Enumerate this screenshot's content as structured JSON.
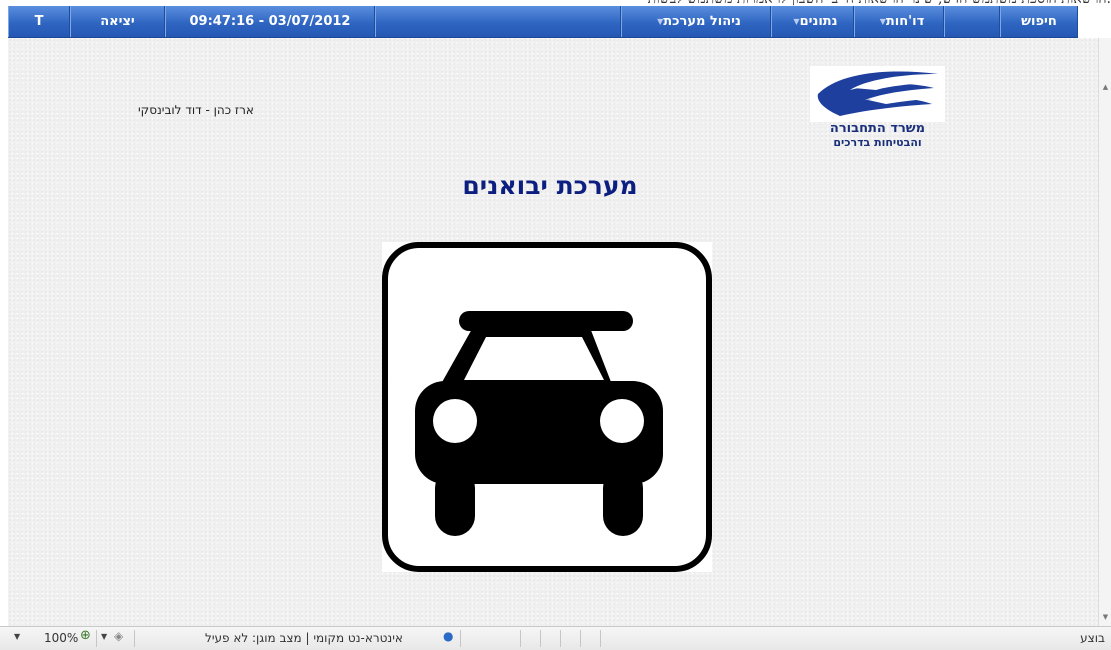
{
  "window": {
    "partial_title": "הרשאות הוספת משתמש חדש, שינוי הרשאות חייבי השבון לו אמרות משתמש לבשות."
  },
  "menubar": {
    "items": [
      {
        "label": "T",
        "has_arrow": false
      },
      {
        "label": "יציאה",
        "has_arrow": false
      },
      {
        "label": "09:47:16 - 03/07/2012",
        "has_arrow": false
      },
      {
        "label": "",
        "has_arrow": false
      },
      {
        "label": "ניהול מערכת",
        "has_arrow": true
      },
      {
        "label": "נתונים",
        "has_arrow": true
      },
      {
        "label": "דו'חות",
        "has_arrow": true
      },
      {
        "label": "",
        "has_arrow": false
      },
      {
        "label": "חיפוש",
        "has_arrow": false
      }
    ],
    "arrow_glyph": "▼"
  },
  "content": {
    "user_line": "ארז כהן - דוד לובינסקי",
    "logo": {
      "line1": "משרד התחבורה",
      "line2": "והבטיחות בדרכים"
    },
    "title": "מערכת יבואנים",
    "picture": "car-icon"
  },
  "statusbar": {
    "zoom": "100%",
    "zone": "אינטרא-נט מקומי | מצב מוגן: לא פעיל",
    "done": "בוצע"
  },
  "colors": {
    "menubar": "#2f66c2",
    "title": "#0c1f80",
    "logo": "#1a2f7a"
  }
}
